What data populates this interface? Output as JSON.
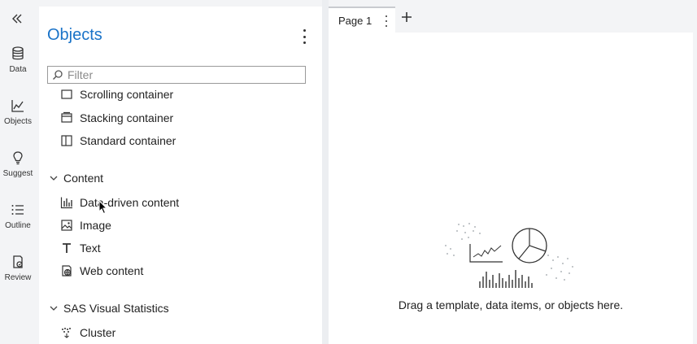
{
  "rail": {
    "items": [
      {
        "label": "Data",
        "icon": "database-icon"
      },
      {
        "label": "Objects",
        "icon": "line-chart-icon"
      },
      {
        "label": "Suggest",
        "icon": "lightbulb-icon"
      },
      {
        "label": "Outline",
        "icon": "list-icon"
      },
      {
        "label": "Review",
        "icon": "review-icon"
      }
    ]
  },
  "panel": {
    "title": "Objects",
    "filter_placeholder": "Filter",
    "partial_item": "Scrolling container",
    "items_containers": [
      "Stacking container",
      "Standard container"
    ],
    "group_content": "Content",
    "items_content": [
      "Data-driven content",
      "Image",
      "Text",
      "Web content"
    ],
    "group_sas": "SAS Visual Statistics",
    "items_sas": [
      "Cluster"
    ]
  },
  "canvas": {
    "tab_label": "Page 1",
    "empty_message": "Drag a template, data items, or objects here."
  },
  "colors": {
    "accent": "#1a73c8",
    "panel_bg": "#ffffff",
    "app_bg": "#f3f4f6"
  }
}
